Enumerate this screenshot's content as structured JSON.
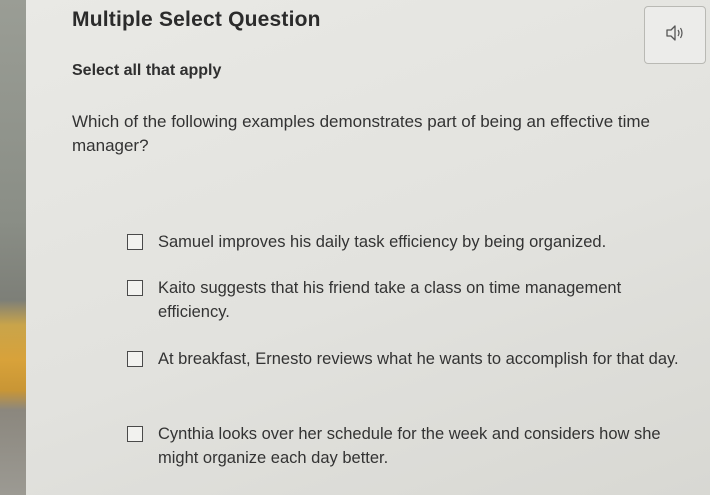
{
  "header": {
    "title": "Multiple Select Question",
    "audio_icon": "speaker-icon"
  },
  "instructions": "Select all that apply",
  "question": "Which of the following examples demonstrates part of being an effective time manager?",
  "options": [
    {
      "text": "Samuel improves his daily task efficiency by being organized.",
      "checked": false
    },
    {
      "text": "Kaito suggests that his friend take a class on time management efficiency.",
      "checked": false
    },
    {
      "text": "At breakfast, Ernesto reviews what he wants to accomplish for that day.",
      "checked": false
    },
    {
      "text": "Cynthia looks over her schedule for the week and considers how she might organize each day better.",
      "checked": false
    }
  ]
}
